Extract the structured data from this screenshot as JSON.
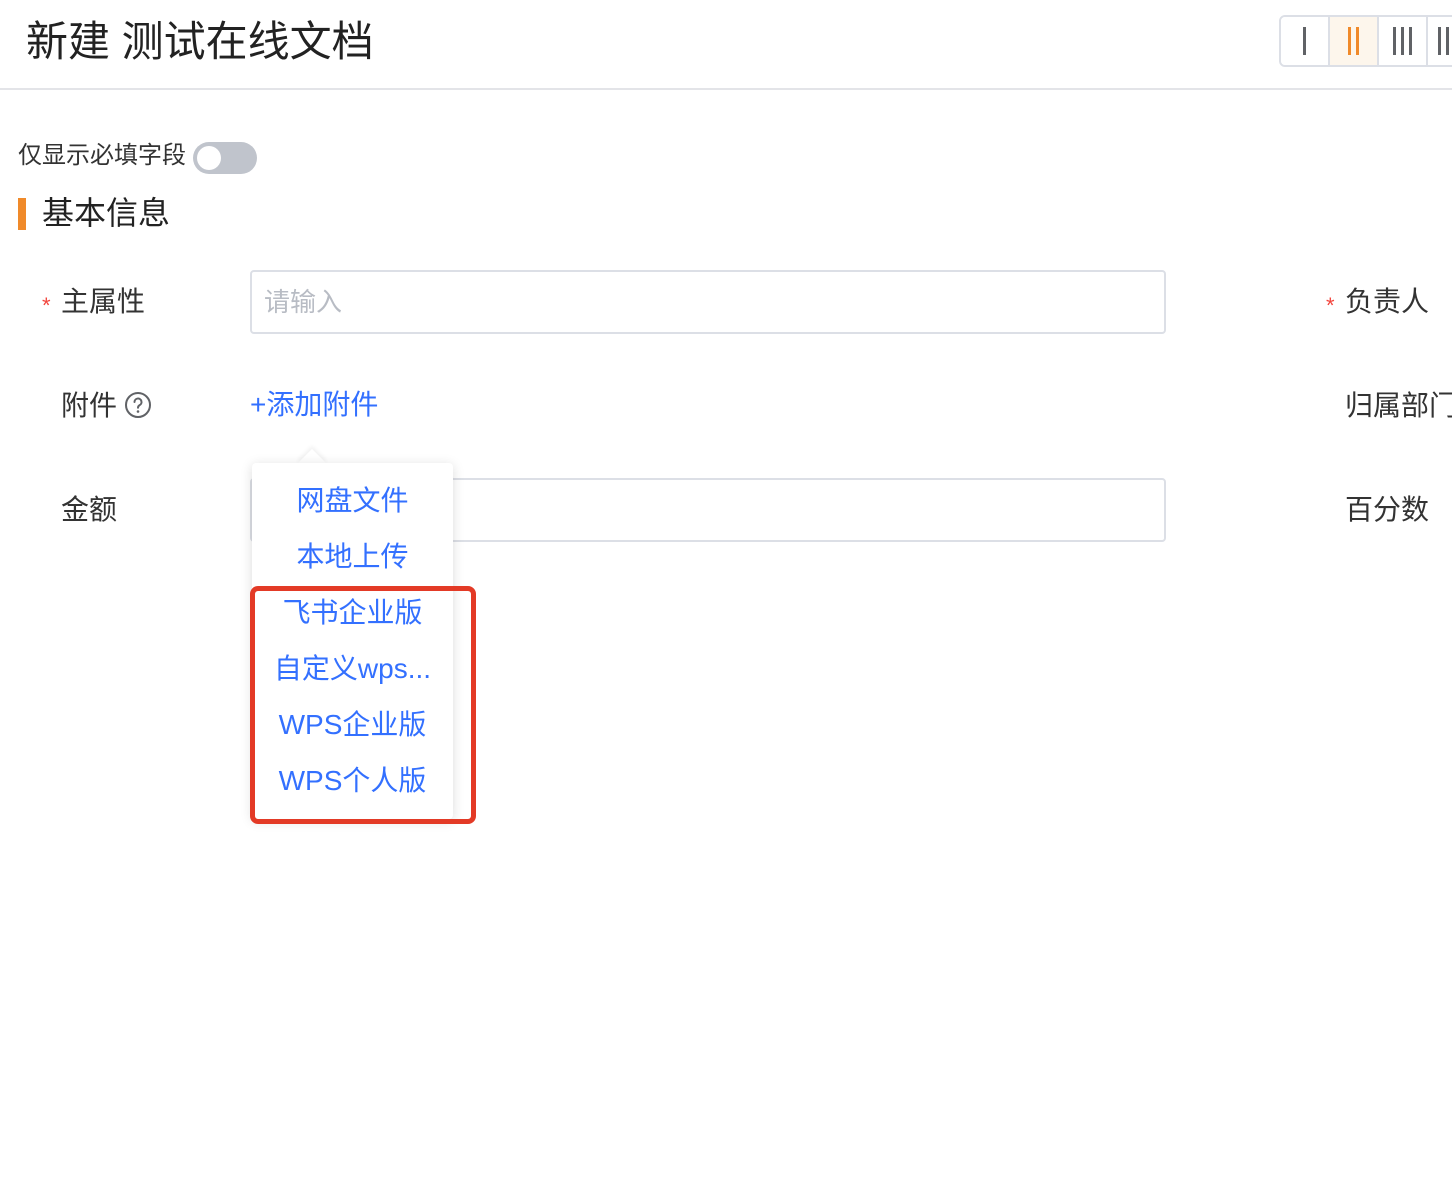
{
  "header": {
    "title": "新建 测试在线文档",
    "layout_options": [
      {
        "name": "single-column",
        "active": false,
        "bars": 1
      },
      {
        "name": "two-column",
        "active": true,
        "bars": 2
      },
      {
        "name": "three-column",
        "active": false,
        "bars": 3
      },
      {
        "name": "four-column",
        "active": false,
        "bars": 4
      }
    ]
  },
  "filters": {
    "required_only_label": "仅显示必填字段",
    "required_only_on": false
  },
  "section": {
    "title": "基本信息"
  },
  "form": {
    "primary_attr_label": "主属性",
    "primary_attr_placeholder": "请输入",
    "primary_attr_value": "",
    "owner_label": "负责人",
    "attachment_label": "附件",
    "add_attachment_label": "+添加附件",
    "department_label": "归属部门",
    "amount_label": "金额",
    "amount_value": "",
    "percentage_label": "百分数"
  },
  "attachment_menu": {
    "items": [
      "网盘文件",
      "本地上传",
      "飞书企业版",
      "自定义wps...",
      "WPS企业版",
      "WPS个人版"
    ]
  },
  "colors": {
    "accent": "#f08a2a",
    "link": "#3370ff",
    "required": "#f2453d",
    "highlight": "#e33a26"
  }
}
